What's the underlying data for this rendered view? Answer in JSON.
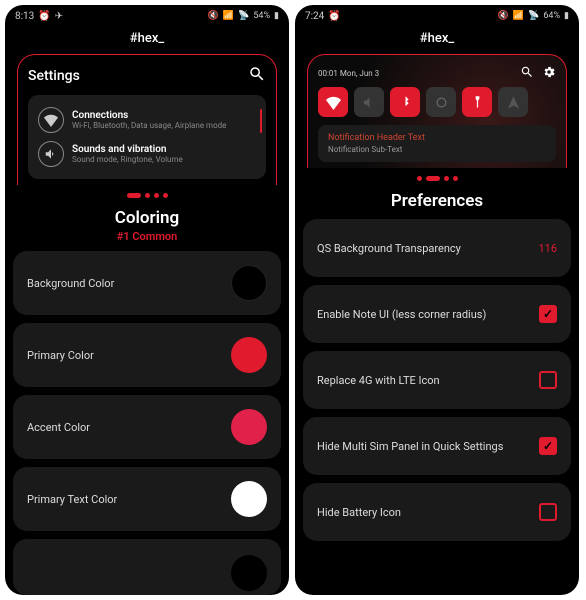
{
  "left": {
    "status": {
      "time": "8:13",
      "battery": "54%"
    },
    "app_title": "#hex_",
    "preview": {
      "header": "Settings",
      "rows": [
        {
          "title": "Connections",
          "sub": "Wi-Fi, Bluetooth, Data usage, Airplane mode"
        },
        {
          "title": "Sounds and vibration",
          "sub": "Sound mode, Ringtone, Volume"
        }
      ]
    },
    "section_title": "Coloring",
    "section_sub": "#1 Common",
    "items": [
      {
        "label": "Background Color",
        "swatch": "#000000"
      },
      {
        "label": "Primary Color",
        "swatch": "#e01b2e"
      },
      {
        "label": "Accent Color",
        "swatch": "#e0214a"
      },
      {
        "label": "Primary Text Color",
        "swatch": "#ffffff"
      }
    ]
  },
  "right": {
    "status": {
      "time": "7:24",
      "battery": "64%"
    },
    "app_title": "#hex_",
    "preview": {
      "datetime": "00:01 Mon, Jun 3",
      "notif_title": "Notification Header Text",
      "notif_sub": "Notification Sub-Text"
    },
    "section_title": "Preferences",
    "items": [
      {
        "label": "QS Background Transparency",
        "kind": "value",
        "value": "116"
      },
      {
        "label": "Enable Note UI (less corner radius)",
        "kind": "check",
        "checked": true
      },
      {
        "label": "Replace 4G with LTE Icon",
        "kind": "check",
        "checked": false
      },
      {
        "label": "Hide Multi Sim Panel in Quick Settings",
        "kind": "check",
        "checked": true
      },
      {
        "label": "Hide Battery Icon",
        "kind": "check",
        "checked": false
      }
    ]
  }
}
